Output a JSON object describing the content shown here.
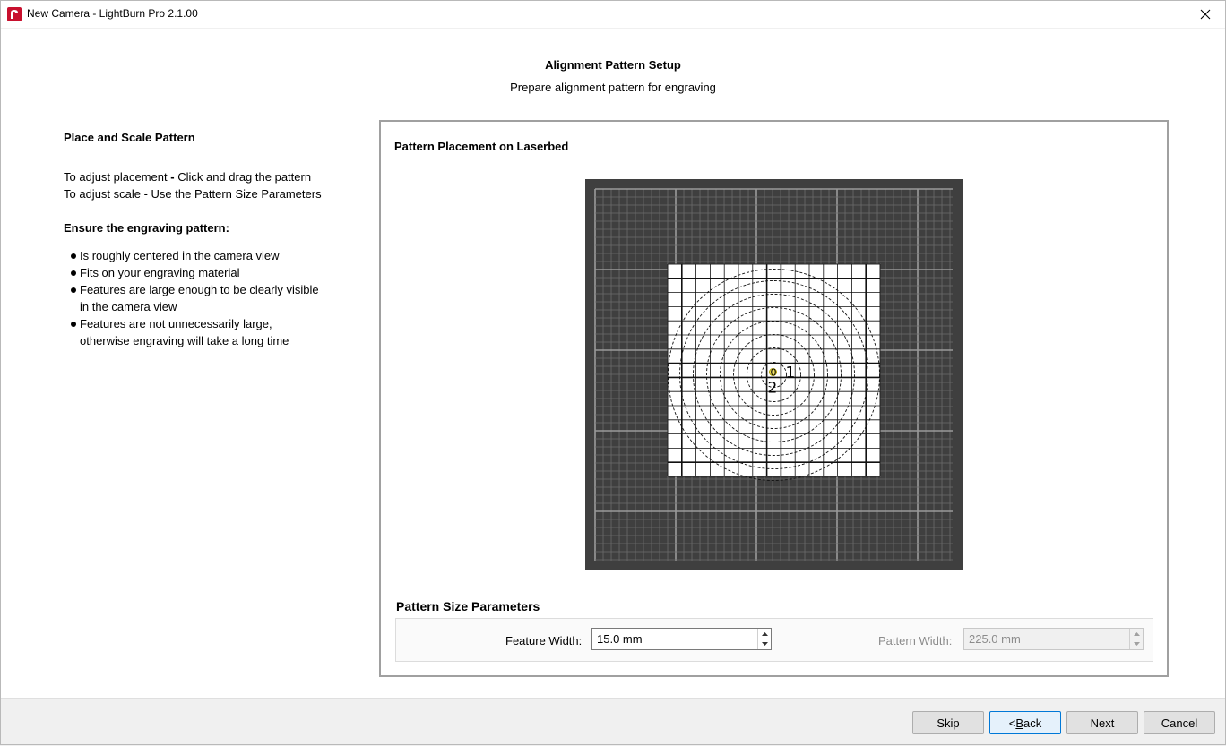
{
  "window": {
    "title": "New Camera - LightBurn Pro 2.1.00",
    "close_icon": "close-icon"
  },
  "header": {
    "title": "Alignment Pattern Setup",
    "subtitle": "Prepare alignment pattern for engraving"
  },
  "instructions": {
    "heading": "Place and Scale Pattern",
    "line1_prefix": "To adjust placement ",
    "line1_dash": "-",
    "line1_suffix": " Click and drag the pattern",
    "line2": "To adjust scale - Use the Pattern Size Parameters",
    "ensure_heading": "Ensure the engraving pattern:",
    "bullets": [
      "Is roughly centered in the camera view",
      "Fits on your engraving material",
      "Features are large enough to be clearly visible",
      "in the camera view",
      "Features are not unnecessarily large,",
      "otherwise engraving will take a long time"
    ]
  },
  "placement": {
    "title": "Pattern Placement on Laserbed",
    "marker_labels": [
      "0",
      "1",
      "2"
    ]
  },
  "params": {
    "title": "Pattern Size Parameters",
    "feature_width_label": "Feature Width:",
    "feature_width_value": "15.0 mm",
    "pattern_width_label": "Pattern Width:",
    "pattern_width_value": "225.0 mm"
  },
  "footer": {
    "skip": "Skip",
    "back_prefix": "< ",
    "back_underlined": "B",
    "back_rest": "ack",
    "next": "Next",
    "cancel": "Cancel"
  }
}
